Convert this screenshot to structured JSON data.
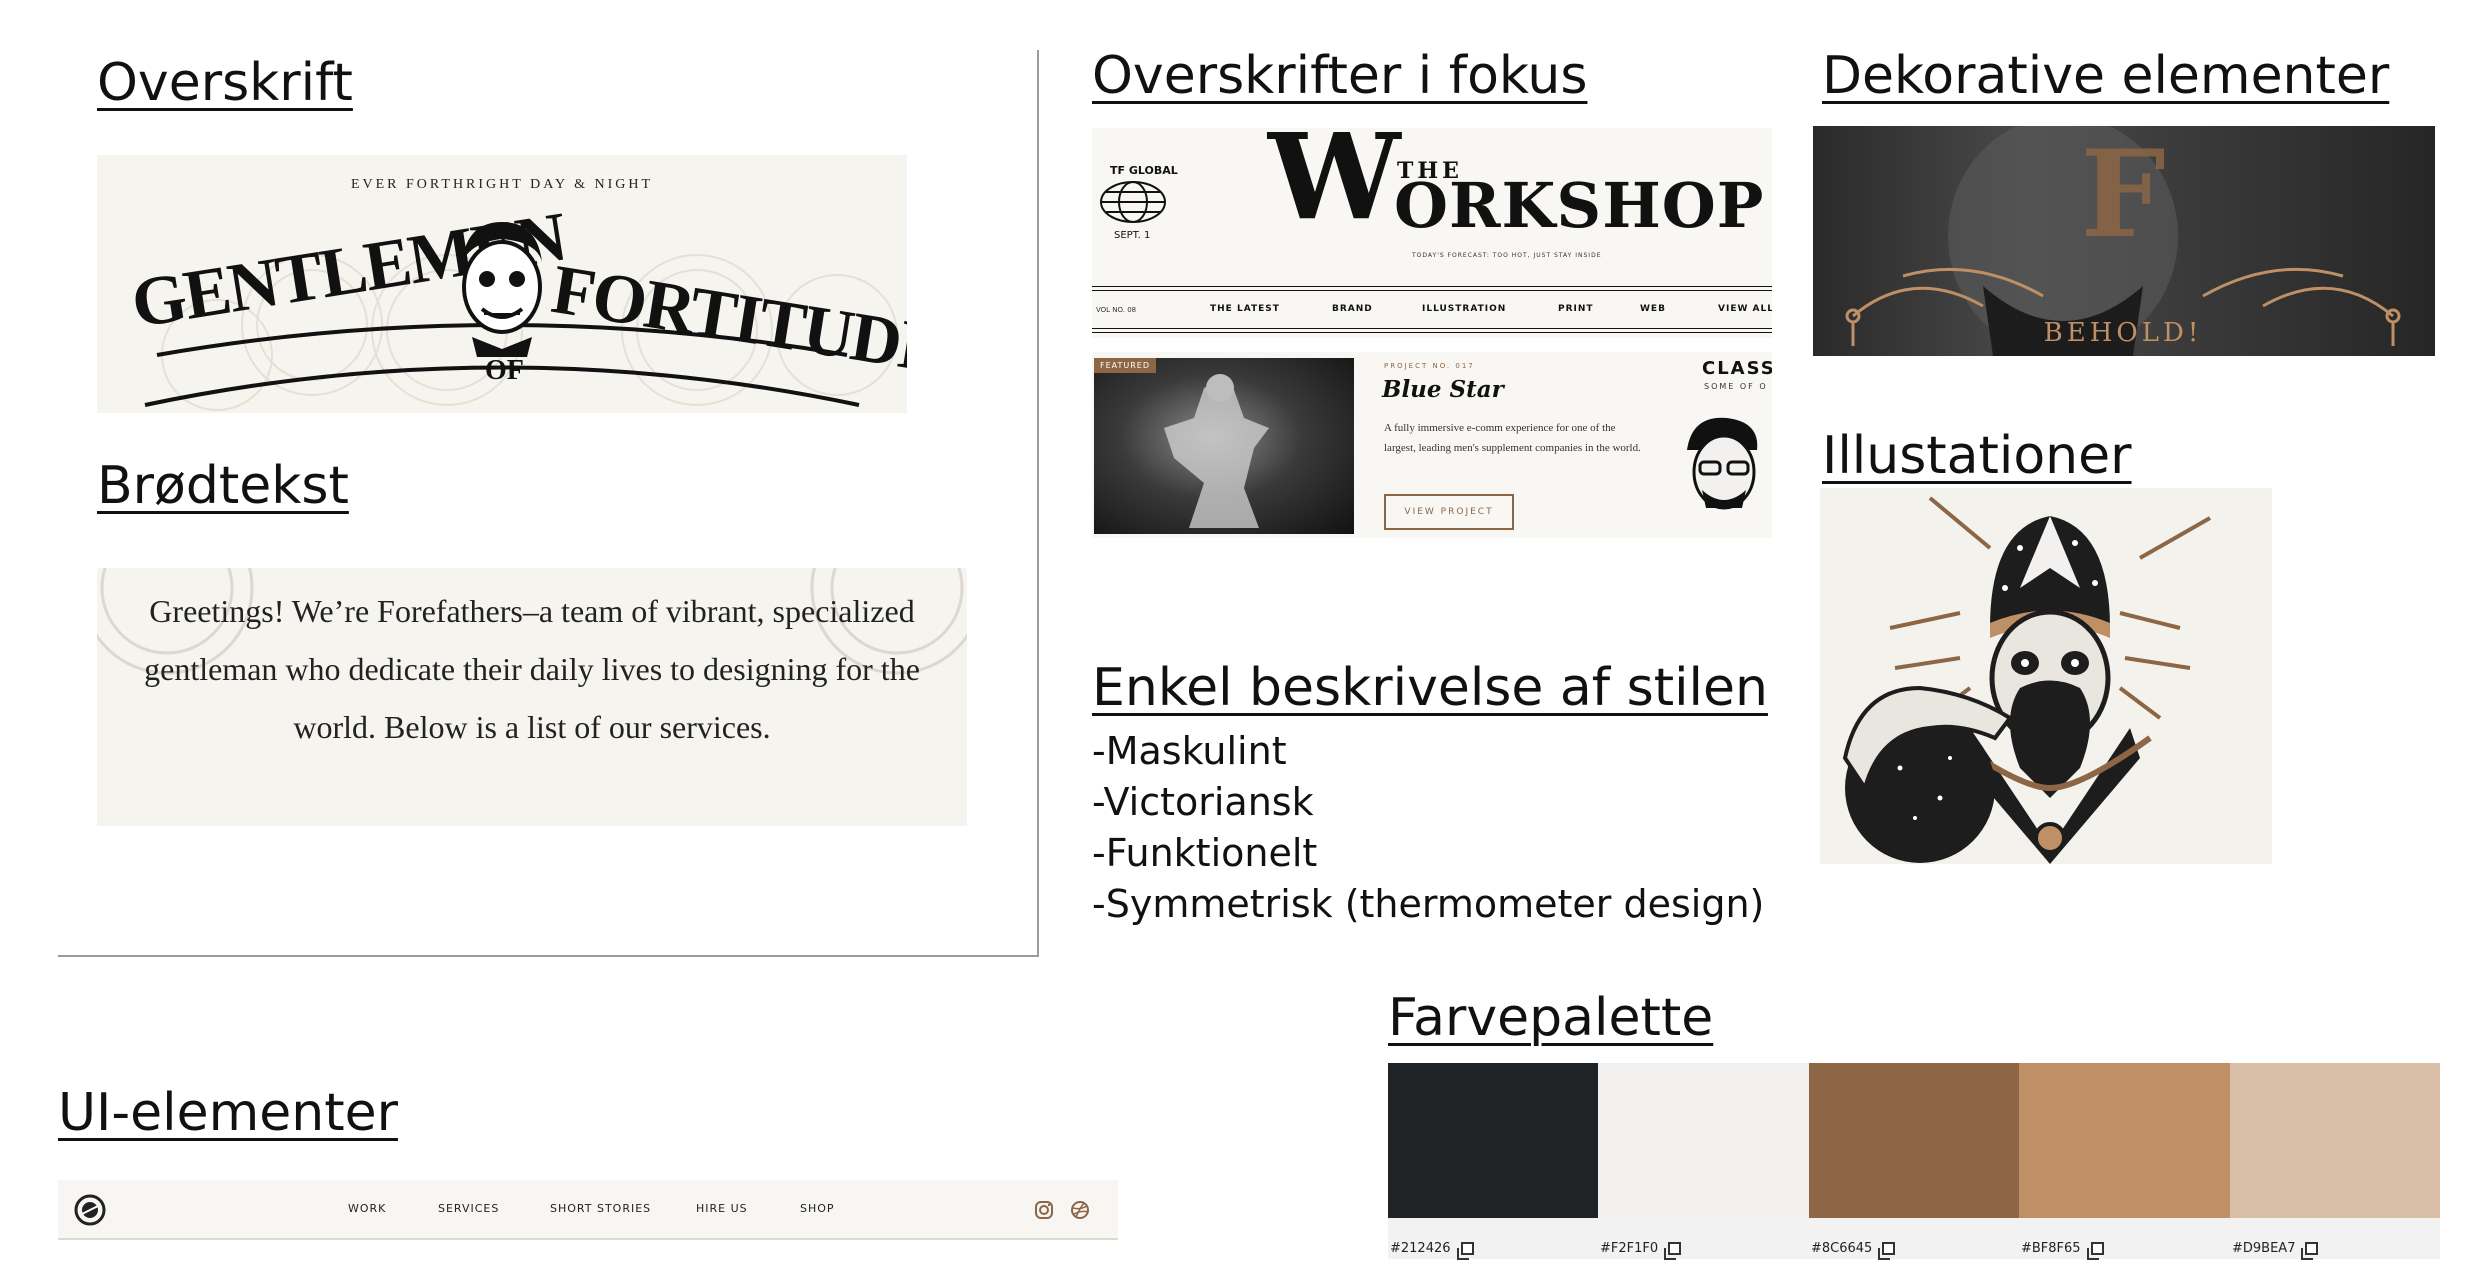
{
  "headings": {
    "overskrift": "Overskrift",
    "brodtekst": "Brødtekst",
    "overskrifter_fokus": "Overskrifter i fokus",
    "dekorative": "Dekorative elementer",
    "illustationer": "Illustationer",
    "beskrivelse": "Enkel beskrivelse af stilen",
    "farvepalette": "Farvepalette",
    "ui_elementer": "UI-elementer"
  },
  "gentlemen_banner": {
    "tagline": "EVER FORTHRIGHT DAY & NIGHT",
    "left_word": "GENTLEMEN",
    "of": "OF",
    "right_word": "FORTITUDE"
  },
  "body_sample": {
    "text": "Greetings! We’re Forefathers–a team of vibrant, specialized gentleman who dedicate their daily lives to designing for the world. Below is a list of our services."
  },
  "workshop": {
    "global_label": "TF GLOBAL",
    "date": "SEPT. 1",
    "title_big": "W",
    "title_the": "THE",
    "title_rest": "ORKSHOP",
    "forecast": "TODAY'S FORECAST: TOO HOT, JUST STAY INSIDE",
    "vol": "VOL NO. 08",
    "nav": [
      "THE LATEST",
      "BRAND",
      "ILLUSTRATION",
      "PRINT",
      "WEB",
      "VIEW ALL"
    ],
    "featured_badge": "FEATURED",
    "project_no": "PROJECT NO. 017",
    "project_title": "Blue Star",
    "project_desc": "A fully immersive e-comm experience for one of the largest, leading men's supplement companies in the world.",
    "view_project": "VIEW PROJECT",
    "class_label": "CLASS",
    "class_sub": "SOME OF O"
  },
  "decorative": {
    "behold": "BEHOLD!"
  },
  "description": {
    "items": [
      "-Maskulint",
      "-Victoriansk",
      "-Funktionelt",
      "-Symmetrisk (thermometer design)"
    ]
  },
  "palette": {
    "colors": [
      {
        "hex": "#212426",
        "label": "#212426"
      },
      {
        "hex": "#F2F1F0",
        "label": "#F2F1F0"
      },
      {
        "hex": "#8C6645",
        "label": "#8C6645"
      },
      {
        "hex": "#BF8F65",
        "label": "#BF8F65"
      },
      {
        "hex": "#D9BEA7",
        "label": "#D9BEA7"
      }
    ]
  },
  "ui_nav": {
    "items": [
      "WORK",
      "SERVICES",
      "SHORT STORIES",
      "HIRE US",
      "SHOP"
    ]
  }
}
